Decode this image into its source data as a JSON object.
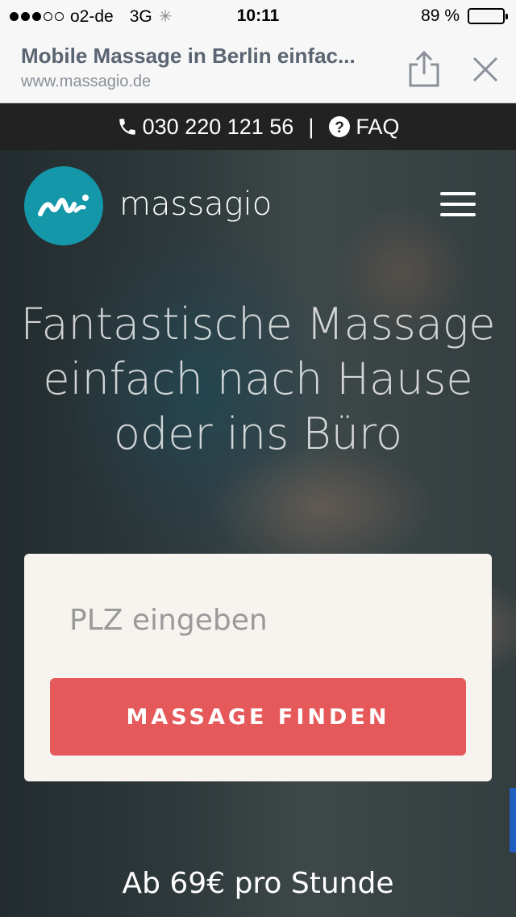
{
  "status_bar": {
    "carrier": "o2-de",
    "network": "3G",
    "time": "10:11",
    "battery_percent": "89 %",
    "battery_level": 0.89
  },
  "browser": {
    "page_title": "Mobile Massage in Berlin einfac...",
    "url": "www.massagio.de",
    "icons": [
      "share-icon",
      "close-icon"
    ]
  },
  "topbar": {
    "phone": "030 220 121 56",
    "separator": "|",
    "faq": "FAQ",
    "icons": [
      "phone-icon",
      "question-icon"
    ]
  },
  "header": {
    "brand": "massagio",
    "icons": [
      "logo-icon",
      "hamburger-menu-icon"
    ]
  },
  "hero": {
    "headline_lines": [
      "Fantastische Massage",
      "einfach nach Hause",
      "oder ins Büro"
    ]
  },
  "form": {
    "plz_placeholder": "PLZ eingeben",
    "plz_value": "",
    "submit_label": "MASSAGE FINDEN"
  },
  "pricing": {
    "text": "Ab 69€ pro Stunde"
  },
  "colors": {
    "accent_red": "#e5595a",
    "brand_teal": "#1597aa",
    "topbar_bg": "#222222"
  }
}
